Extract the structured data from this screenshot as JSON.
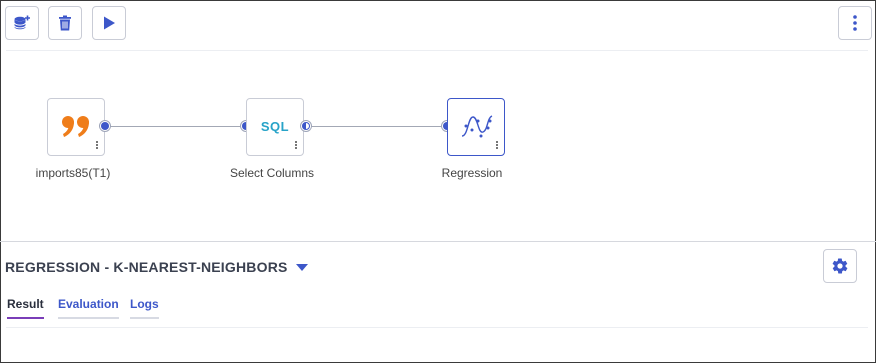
{
  "toolbar": {
    "add_data_icon": "database-plus-icon",
    "delete_icon": "trash-icon",
    "run_icon": "play-icon",
    "more_icon": "vertical-dots-icon"
  },
  "flow": {
    "nodes": [
      {
        "id": "imports",
        "label": "imports85(T1)",
        "icon": "quote-icon",
        "icon_color": "#ef7d1a"
      },
      {
        "id": "select",
        "label": "Select Columns",
        "icon": "sql-icon",
        "icon_text": "SQL",
        "icon_color": "#27a3c8"
      },
      {
        "id": "regression",
        "label": "Regression",
        "icon": "regression-curve-icon",
        "icon_color": "#3d57c9"
      }
    ]
  },
  "panel": {
    "title": "REGRESSION - K-NEAREST-NEIGHBORS",
    "settings_icon": "gear-icon",
    "tabs": [
      {
        "label": "Result",
        "active": true
      },
      {
        "label": "Evaluation",
        "active": false
      },
      {
        "label": "Logs",
        "active": false
      }
    ]
  },
  "colors": {
    "accent": "#3d57c9",
    "active_tab_underline": "#7a3db8",
    "quote_icon": "#ef7d1a",
    "sql_icon": "#27a3c8"
  }
}
